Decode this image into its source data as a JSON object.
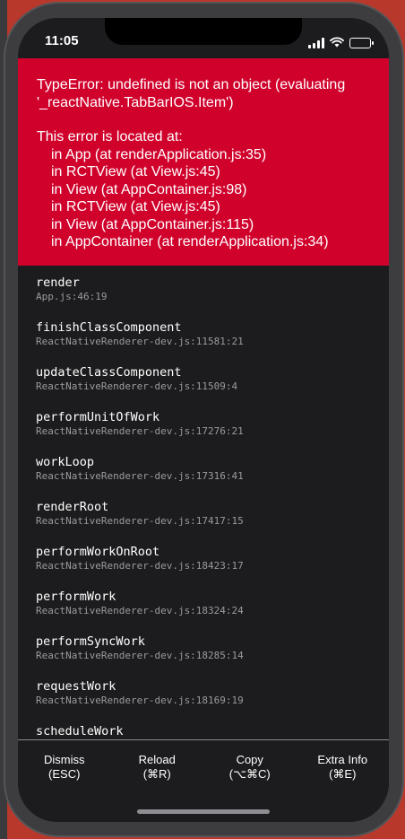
{
  "status_bar": {
    "time": "11:05"
  },
  "error": {
    "message": "TypeError: undefined is not an object (evaluating '_reactNative.TabBarIOS.Item')",
    "location_title": "This error is located at:",
    "location_lines": [
      "in App (at renderApplication.js:35)",
      "in RCTView (at View.js:45)",
      "in View (at AppContainer.js:98)",
      "in RCTView (at View.js:45)",
      "in View (at AppContainer.js:115)",
      "in AppContainer (at renderApplication.js:34)"
    ]
  },
  "stack": [
    {
      "method": "render",
      "file": "App.js:46:19"
    },
    {
      "method": "finishClassComponent",
      "file": "ReactNativeRenderer-dev.js:11581:21"
    },
    {
      "method": "updateClassComponent",
      "file": "ReactNativeRenderer-dev.js:11509:4"
    },
    {
      "method": "performUnitOfWork",
      "file": "ReactNativeRenderer-dev.js:17276:21"
    },
    {
      "method": "workLoop",
      "file": "ReactNativeRenderer-dev.js:17316:41"
    },
    {
      "method": "renderRoot",
      "file": "ReactNativeRenderer-dev.js:17417:15"
    },
    {
      "method": "performWorkOnRoot",
      "file": "ReactNativeRenderer-dev.js:18423:17"
    },
    {
      "method": "performWork",
      "file": "ReactNativeRenderer-dev.js:18324:24"
    },
    {
      "method": "performSyncWork",
      "file": "ReactNativeRenderer-dev.js:18285:14"
    },
    {
      "method": "requestWork",
      "file": "ReactNativeRenderer-dev.js:18169:19"
    },
    {
      "method": "scheduleWork",
      "file": ""
    }
  ],
  "footer": {
    "dismiss": {
      "label": "Dismiss",
      "shortcut": "(ESC)"
    },
    "reload": {
      "label": "Reload",
      "shortcut": "(⌘R)"
    },
    "copy": {
      "label": "Copy",
      "shortcut": "(⌥⌘C)"
    },
    "extra_info": {
      "label": "Extra Info",
      "shortcut": "(⌘E)"
    }
  },
  "colors": {
    "error_red": "#d0022c",
    "screen_bg": "#1c1c1e",
    "file_text": "#9a9a9e"
  },
  "icons": {
    "signal": "cellular-signal-icon",
    "wifi": "wifi-icon",
    "battery": "battery-icon"
  }
}
